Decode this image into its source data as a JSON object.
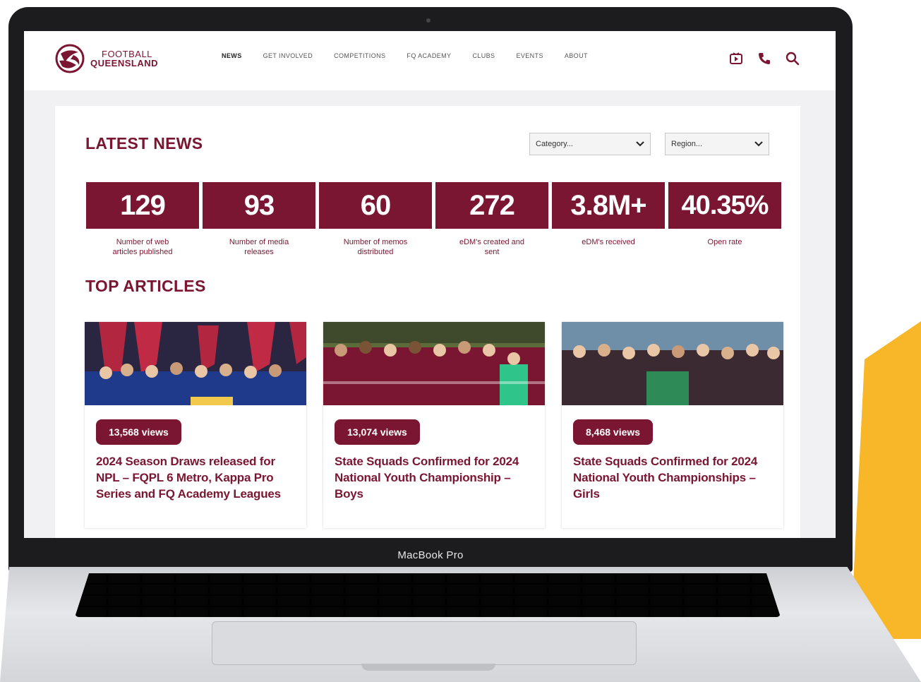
{
  "device": {
    "label": "MacBook Pro"
  },
  "header": {
    "logo_line1": "FOOTBALL",
    "logo_line2": "QUEENSLAND",
    "nav": [
      "NEWS",
      "GET INVOLVED",
      "COMPETITIONS",
      "FQ ACADEMY",
      "CLUBS",
      "EVENTS",
      "ABOUT"
    ],
    "icons": [
      "video-icon",
      "phone-icon",
      "search-icon"
    ]
  },
  "latest_news": {
    "title": "LATEST NEWS",
    "category_placeholder": "Category...",
    "region_placeholder": "Region..."
  },
  "stats": [
    {
      "value": "129",
      "label": "Number of web articles published"
    },
    {
      "value": "93",
      "label": "Number of media releases"
    },
    {
      "value": "60",
      "label": "Number of memos distributed"
    },
    {
      "value": "272",
      "label": "eDM's created and sent"
    },
    {
      "value": "3.8M+",
      "label": "eDM's received"
    },
    {
      "value": "40.35%",
      "label": "Open rate"
    }
  ],
  "top_articles": {
    "title": "TOP ARTICLES",
    "items": [
      {
        "views": "13,568 views",
        "title": "2024 Season Draws released for NPL – FQPL 6 Metro, Kappa Pro Series and FQ Academy Leagues"
      },
      {
        "views": "13,074 views",
        "title": "State Squads Confirmed for 2024 National Youth Championship – Boys"
      },
      {
        "views": "8,468 views",
        "title": "State Squads Confirmed for 2024 National Youth Championships – Girls"
      }
    ]
  },
  "colors": {
    "brand": "#7a1631",
    "accent_yellow": "#f7b728"
  }
}
